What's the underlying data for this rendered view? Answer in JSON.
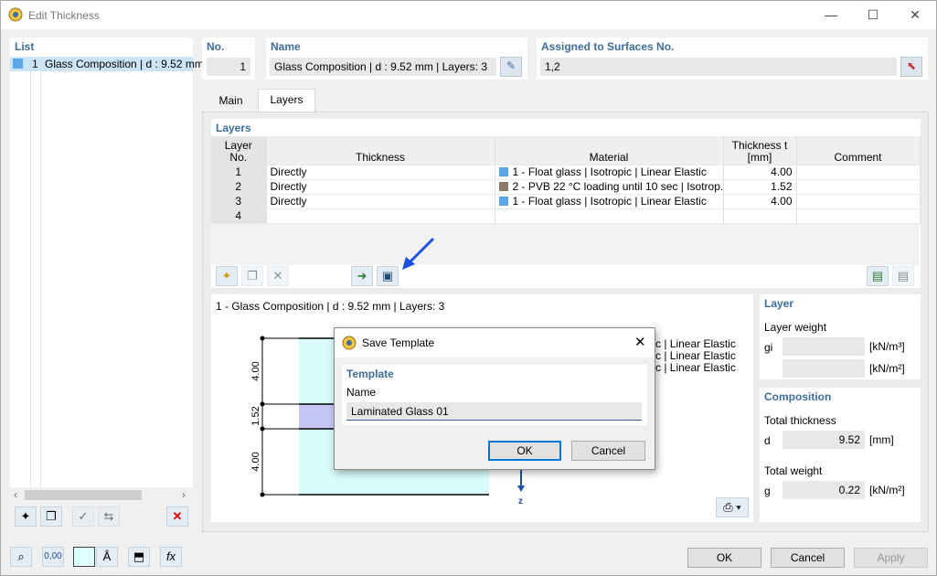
{
  "window": {
    "title": "Edit Thickness",
    "close": "✕",
    "minimize": "—",
    "maximize": "☐"
  },
  "list": {
    "header": "List",
    "items": [
      {
        "number": "1",
        "label": "Glass Composition | d : 9.52 mm",
        "color": "#5ba8e8"
      }
    ]
  },
  "header": {
    "no_label": "No.",
    "no_value": "1",
    "name_label": "Name",
    "name_value": "Glass Composition | d : 9.52 mm | Layers: 3",
    "assigned_label": "Assigned to Surfaces No.",
    "assigned_value": "1,2"
  },
  "tabs": [
    {
      "label": "Main"
    },
    {
      "label": "Layers"
    }
  ],
  "layers": {
    "title": "Layers",
    "columns": {
      "layer_no": "Layer No.",
      "thickness": "Thickness",
      "material": "Material",
      "t_mm": "Thickness t [mm]",
      "comment": "Comment"
    },
    "rows": [
      {
        "no": "1",
        "thickness": "Directly",
        "material": "1 - Float glass | Isotropic | Linear Elastic",
        "color": "#5ba8e8",
        "t": "4.00",
        "comment": ""
      },
      {
        "no": "2",
        "thickness": "Directly",
        "material": "2 - PVB 22 °C loading until 10 sec | Isotrop...",
        "color": "#8c7b6a",
        "t": "1.52",
        "comment": ""
      },
      {
        "no": "3",
        "thickness": "Directly",
        "material": "1 - Float glass | Isotropic | Linear Elastic",
        "color": "#5ba8e8",
        "t": "4.00",
        "comment": ""
      },
      {
        "no": "4",
        "thickness": "",
        "material": "",
        "color": "",
        "t": "",
        "comment": ""
      }
    ]
  },
  "preview": {
    "title": "1 - Glass Composition | d : 9.52 mm | Layers: 3",
    "dims": [
      "4.00",
      "1.52",
      "4.00"
    ],
    "axis": "z",
    "legend": [
      "1 - Float glass | Isotropic | Linear Elastic",
      "2 - PVB 22 °C loading until 10 sec | Isotropic | Linear Elastic",
      "1 - Float glass | Isotropic | Linear Elastic"
    ],
    "legend_visible": [
      "c | Linear Elastic",
      "c | Linear Elastic",
      "c | Linear Elastic"
    ]
  },
  "layer_info": {
    "title": "Layer",
    "weight_label": "Layer weight",
    "gi_label": "gi",
    "unit1": "[kN/m³]",
    "unit2": "[kN/m²]"
  },
  "composition": {
    "title": "Composition",
    "total_thickness_label": "Total thickness",
    "d_label": "d",
    "d_value": "9.52",
    "d_unit": "[mm]",
    "total_weight_label": "Total weight",
    "g_label": "g",
    "g_value": "0.22",
    "g_unit": "[kN/m²]"
  },
  "dialog": {
    "title": "Save Template",
    "section": "Template",
    "name_label": "Name",
    "name_value": "Laminated Glass 01",
    "ok": "OK",
    "cancel": "Cancel"
  },
  "footer": {
    "ok": "OK",
    "cancel": "Cancel",
    "apply": "Apply",
    "num_icon": "0,00"
  }
}
